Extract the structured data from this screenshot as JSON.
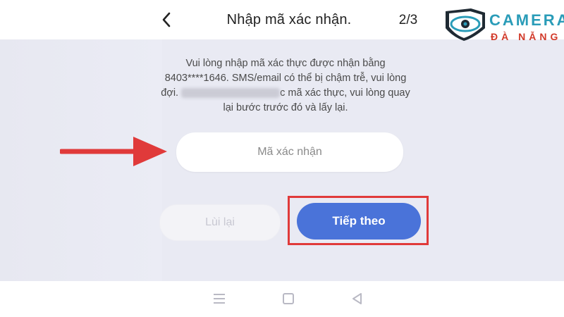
{
  "header": {
    "title": "Nhập mã xác nhận.",
    "step": "2/3"
  },
  "instruction": {
    "line1": "Vui lòng nhập mã xác thực được nhận bằng",
    "line2": "8403****1646. SMS/email có thể bị chậm trễ, vui lòng",
    "line3_prefix": "đợi.",
    "line3_suffix": "c mã xác thực, vui lòng quay",
    "line4": "lại bước trước đó và lấy lại."
  },
  "code_field": {
    "placeholder": "Mã xác nhận",
    "value": ""
  },
  "buttons": {
    "back_label": "Lùi lại",
    "next_label": "Tiếp theo"
  },
  "watermark": {
    "line1": "CAMERA",
    "line2": "ĐÀ NẴNG"
  },
  "colors": {
    "accent": "#4a73d9",
    "highlight": "#e03a3a",
    "arrow": "#e03a3a"
  },
  "icons": {
    "back": "chevron-left-icon",
    "nav_recent": "menu-icon",
    "nav_home": "square-home-icon",
    "nav_back": "triangle-back-icon"
  }
}
